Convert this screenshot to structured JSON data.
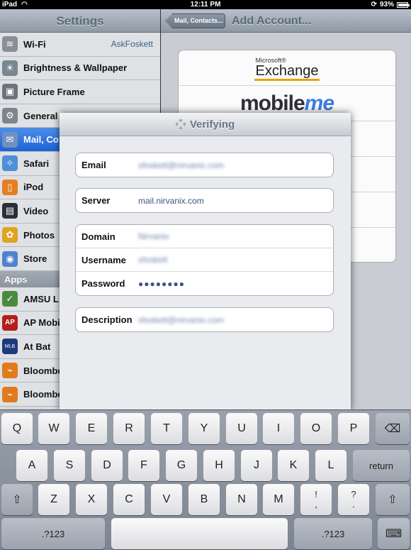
{
  "status": {
    "carrier": "iPad",
    "time": "12:11 PM",
    "battery": "93%",
    "battery_level": 0.93
  },
  "sidebar": {
    "title": "Settings",
    "items": [
      {
        "label": "Wi-Fi",
        "value": "AskFoskett",
        "icon": "wifi-icon",
        "color": "#8a8f96"
      },
      {
        "label": "Brightness & Wallpaper",
        "value": "",
        "icon": "brightness-icon",
        "color": "#7b8790"
      },
      {
        "label": "Picture Frame",
        "value": "",
        "icon": "picture-frame-icon",
        "color": "#6c737c"
      },
      {
        "label": "General",
        "value": "",
        "icon": "gear-icon",
        "color": "#7e848b"
      },
      {
        "label": "Mail, Co",
        "value": "",
        "icon": "mail-icon",
        "color": "#6e90c2"
      },
      {
        "label": "Safari",
        "value": "",
        "icon": "safari-icon",
        "color": "#4e8fd8"
      },
      {
        "label": "iPod",
        "value": "",
        "icon": "ipod-icon",
        "color": "#e77d22"
      },
      {
        "label": "Video",
        "value": "",
        "icon": "video-icon",
        "color": "#2c3036"
      },
      {
        "label": "Photos",
        "value": "",
        "icon": "photos-icon",
        "color": "#e0a421"
      },
      {
        "label": "Store",
        "value": "",
        "icon": "store-icon",
        "color": "#4f82cf"
      }
    ],
    "apps_header": "Apps",
    "apps": [
      {
        "label": "AMSU L",
        "icon": "amsu-icon",
        "color": "#4b8a3e"
      },
      {
        "label": "AP Mobi",
        "icon": "ap-icon",
        "color": "#b51d1d"
      },
      {
        "label": "At Bat",
        "icon": "mlb-icon",
        "color": "#1e3a7a"
      },
      {
        "label": "Bloombe",
        "icon": "bloomberg-icon",
        "color": "#e07b1c"
      },
      {
        "label": "Bloombe",
        "icon": "bloomberg-icon",
        "color": "#e07b1c"
      }
    ]
  },
  "detail": {
    "back_label": "Mail, Contacts...",
    "title": "Add Account...",
    "accounts": {
      "exchange_ms": "Microsoft®",
      "exchange": "Exchange",
      "mobileme_a": "mobile",
      "mobileme_b": "me"
    }
  },
  "modal": {
    "title": "Verifying",
    "email": {
      "label": "Email",
      "value": "sfoskett@nirvanix.com"
    },
    "server": {
      "label": "Server",
      "value": "mail.nirvanix.com"
    },
    "domain": {
      "label": "Domain",
      "value": "Nirvanix"
    },
    "username": {
      "label": "Username",
      "value": "sfoskett"
    },
    "password": {
      "label": "Password",
      "value": "●●●●●●●●"
    },
    "description": {
      "label": "Description",
      "value": "sfoskett@nirvanix.com"
    }
  },
  "keyboard": {
    "row1": [
      "Q",
      "W",
      "E",
      "R",
      "T",
      "Y",
      "U",
      "I",
      "O",
      "P"
    ],
    "row2": [
      "A",
      "S",
      "D",
      "F",
      "G",
      "H",
      "J",
      "K",
      "L"
    ],
    "row3": [
      "Z",
      "X",
      "C",
      "V",
      "B",
      "N",
      "M"
    ],
    "return": "return",
    "numbers": ".?123",
    "punct1": [
      "!",
      ","
    ],
    "punct2": [
      "?",
      "."
    ]
  }
}
